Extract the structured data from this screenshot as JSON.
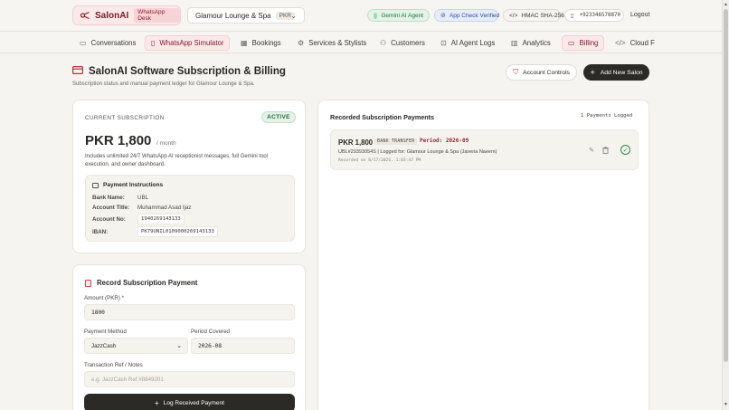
{
  "header": {
    "brand_name": "SalonAI",
    "brand_tag": "WhatsApp Desk",
    "salon_name": "Glamour Lounge & Spa",
    "salon_currency": "PKR",
    "status_gemini": "Gemini AI Agent",
    "status_appcheck": "App Check Verified",
    "status_hmac": "HMAC SHA-256",
    "phone": "+923346578870",
    "logout": "Logout"
  },
  "nav": {
    "items": [
      {
        "label": "Conversations",
        "icon": "chat-icon"
      },
      {
        "label": "WhatsApp Simulator",
        "icon": "phone-icon",
        "active": true
      },
      {
        "label": "Bookings",
        "icon": "calendar-icon"
      },
      {
        "label": "Services & Stylists",
        "icon": "gear-icon"
      },
      {
        "label": "Customers",
        "icon": "users-icon"
      },
      {
        "label": "AI Agent Logs",
        "icon": "bot-icon"
      },
      {
        "label": "Analytics",
        "icon": "bar-chart-icon"
      },
      {
        "label": "Billing",
        "icon": "card-icon",
        "active": true
      },
      {
        "label": "Cloud F",
        "icon": "code-icon"
      }
    ]
  },
  "page": {
    "title": "SalonAI Software Subscription & Billing",
    "subtitle": "Subscription status and manual payment ledger for Glamour Lounge & Spa.",
    "account_controls": "Account Controls",
    "add_salon": "Add New Salon"
  },
  "subscription": {
    "label": "CURRENT SUBSCRIPTION",
    "status": "ACTIVE",
    "price": "PKR 1,800",
    "unit": "/ month",
    "description": "Includes unlimited 24/7 WhatsApp AI receptionist messages, full Gemini tool execution, and owner dashboard.",
    "instructions_title": "Payment Instructions",
    "bank_name_label": "Bank Name:",
    "bank_name": "UBL",
    "account_title_label": "Account Title:",
    "account_title": "Muhammad Asad Ijaz",
    "account_no_label": "Account No:",
    "account_no": "1940269143133",
    "iban_label": "IBAN:",
    "iban": "PK79UNIL0109000269143133"
  },
  "record": {
    "title": "Record Subscription Payment",
    "amount_label": "Amount (PKR) *",
    "amount_value": "1800",
    "method_label": "Payment Method",
    "method_value": "JazzCash",
    "period_label": "Period Covered",
    "period_value": "2026-08",
    "ref_label": "Transaction Ref / Notes",
    "ref_placeholder": "e.g. JazzCash Ref #8849201",
    "submit": "Log Received Payment"
  },
  "payments": {
    "title": "Recorded Subscription Payments",
    "count": "1 Payments Logged",
    "entries": [
      {
        "amount": "PKR 1,800",
        "method": "BANK TRANSFER",
        "period": "Period: 2026-09",
        "details": "UBL#29393054S | Logged for: Glamour Lounge & Spa (Javeria Naeem)",
        "recorded": "Recorded on 8/17/2026, 1:03:47 PM"
      }
    ]
  },
  "colors": {
    "brand": "#7a1a23",
    "accent_bg": "#fbe9ea",
    "dark_button": "#2c2a26",
    "success": "#2c8a4b",
    "period_text": "#9a2330"
  }
}
